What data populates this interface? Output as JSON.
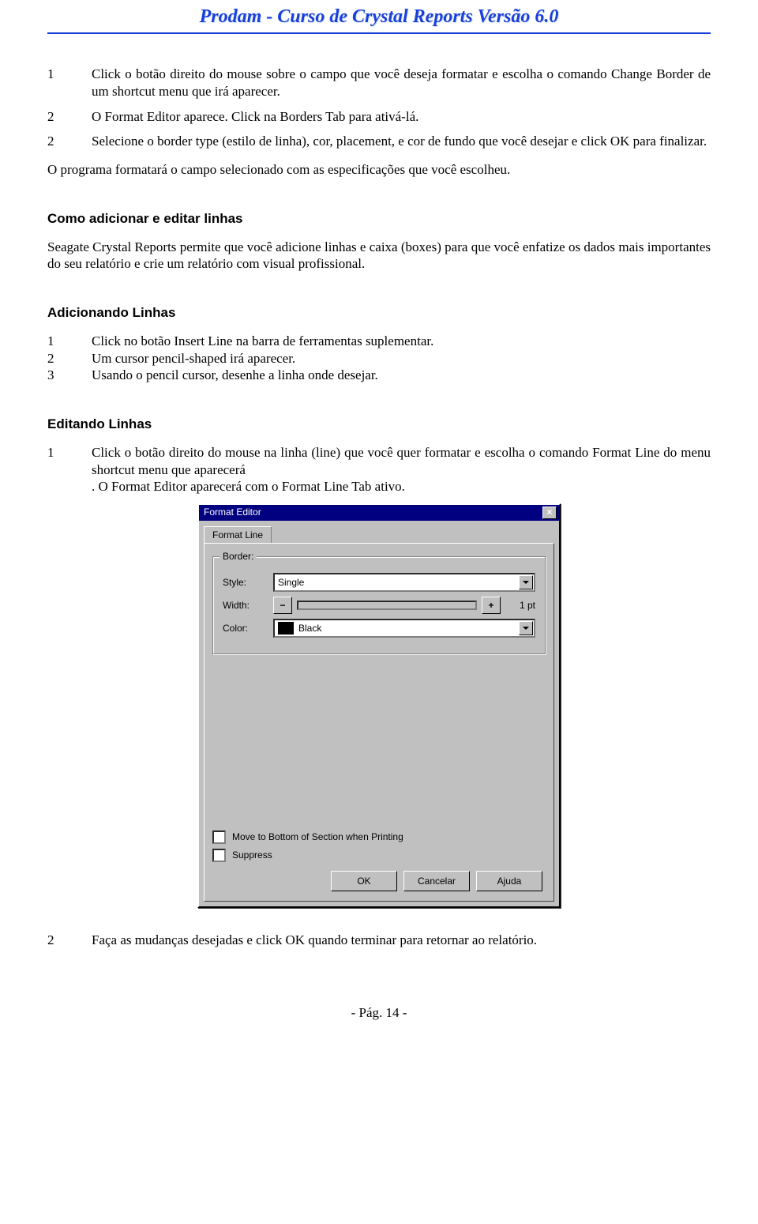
{
  "header": "Prodam  -  Curso de Crystal Reports Versão 6.0",
  "step1": {
    "n": "1",
    "t": "Click o botão direito do mouse sobre  o campo que você deseja formatar e escolha o comando Change Border  de um shortcut menu que irá aparecer."
  },
  "step2": {
    "n": "2",
    "t": "O Format Editor aparece. Click na Borders Tab para ativá-lá."
  },
  "step3": {
    "n": "2",
    "t": "Selecione o  border type (estilo de linha), cor, placement, e cor de fundo  que você desejar e click OK para finalizar."
  },
  "after1": "O programa formatará o campo selecionado com as especificações que você escolheu.",
  "h_add": "Como adicionar e editar linhas",
  "intro": "Seagate Crystal Reports permite que você adicione linhas e caixa (boxes) para que você enfatize os dados mais importantes do seu relatório e crie um relatório com visual profissional.",
  "h_addlines": "Adicionando Linhas",
  "al1": {
    "n": "1",
    "t": "Click no botão Insert Line na barra de ferramentas suplementar."
  },
  "al2": {
    "n": "2",
    "t": "Um cursor pencil-shaped irá aparecer."
  },
  "al3": {
    "n": "3",
    "t": "Usando o pencil cursor, desenhe a linha onde  desejar."
  },
  "h_editlines": "Editando Linhas",
  "el1": {
    "n": "1",
    "t": "Click o botão direito do mouse na linha (line) que você quer formatar e escolha o comando Format Line do menu shortcut menu que aparecerá"
  },
  "el1b": ". O Format Editor aparecerá com o  Format Line Tab ativo.",
  "dlg": {
    "title": "Format Editor",
    "tab": "Format Line",
    "group": "Border:",
    "style_label": "Style:",
    "style_value": "Single",
    "width_label": "Width:",
    "width_value": "1 pt",
    "color_label": "Color:",
    "color_value": "Black",
    "chk1": "Move to Bottom of Section when Printing",
    "chk2": "Suppress",
    "ok": "OK",
    "cancel": "Cancelar",
    "help": "Ajuda"
  },
  "final": {
    "n": "2",
    "t": "Faça as mudanças desejadas e click OK quando  terminar para retornar ao relatório."
  },
  "footer": "- Pág. 14 -"
}
